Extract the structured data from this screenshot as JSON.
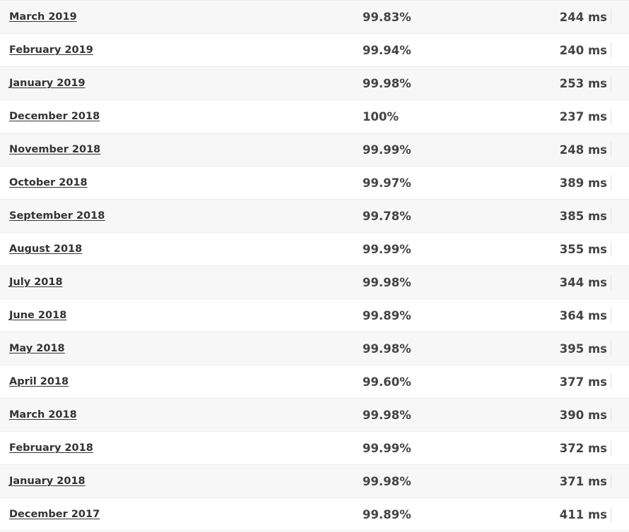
{
  "table": {
    "rows": [
      {
        "month": "March 2019",
        "uptime": "99.83%",
        "response": "244 ms"
      },
      {
        "month": "February 2019",
        "uptime": "99.94%",
        "response": "240 ms"
      },
      {
        "month": "January 2019",
        "uptime": "99.98%",
        "response": "253 ms"
      },
      {
        "month": "December 2018",
        "uptime": "100%",
        "response": "237 ms"
      },
      {
        "month": "November 2018",
        "uptime": "99.99%",
        "response": "248 ms"
      },
      {
        "month": "October 2018",
        "uptime": "99.97%",
        "response": "389 ms"
      },
      {
        "month": "September 2018",
        "uptime": "99.78%",
        "response": "385 ms"
      },
      {
        "month": "August 2018",
        "uptime": "99.99%",
        "response": "355 ms"
      },
      {
        "month": "July 2018",
        "uptime": "99.98%",
        "response": "344 ms"
      },
      {
        "month": "June 2018",
        "uptime": "99.89%",
        "response": "364 ms"
      },
      {
        "month": "May 2018",
        "uptime": "99.98%",
        "response": "395 ms"
      },
      {
        "month": "April 2018",
        "uptime": "99.60%",
        "response": "377 ms"
      },
      {
        "month": "March 2018",
        "uptime": "99.98%",
        "response": "390 ms"
      },
      {
        "month": "February 2018",
        "uptime": "99.99%",
        "response": "372 ms"
      },
      {
        "month": "January 2018",
        "uptime": "99.98%",
        "response": "371 ms"
      },
      {
        "month": "December 2017",
        "uptime": "99.89%",
        "response": "411 ms"
      }
    ]
  },
  "colors": {
    "row_alt_bg": "#f7f7f7",
    "row_bg": "#ffffff",
    "border": "#ececec",
    "text": "#333333"
  }
}
